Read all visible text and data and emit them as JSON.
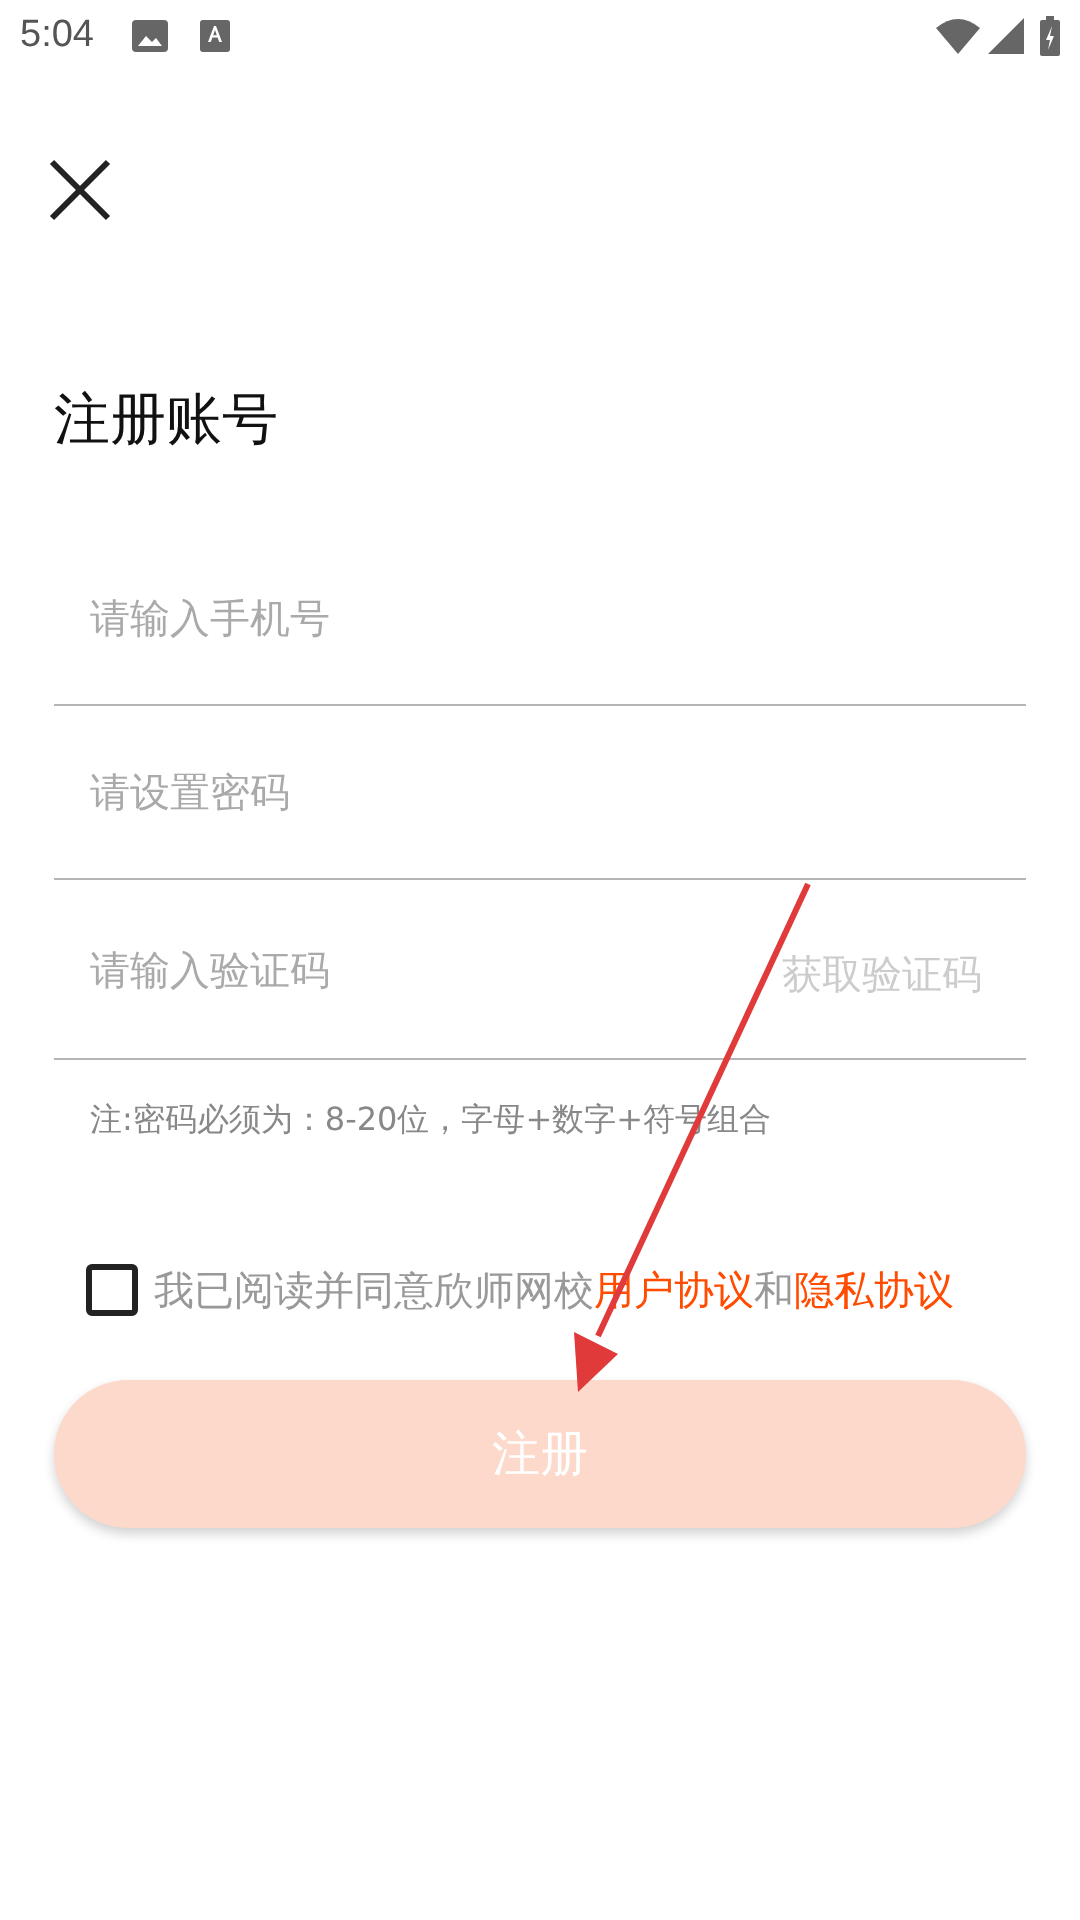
{
  "status_bar": {
    "time": "5:04"
  },
  "title": "注册账号",
  "fields": [
    {
      "placeholder": "请输入手机号"
    },
    {
      "placeholder": "请设置密码"
    },
    {
      "placeholder": "请输入验证码",
      "action": "获取验证码"
    }
  ],
  "hint": "注:密码必须为：8-20位，字母+数字+符号组合",
  "agreement": {
    "checked": false,
    "text": "我已阅读并同意欣师网校",
    "link_1": "用户协议",
    "joiner": "和",
    "link_2": "隐私协议"
  },
  "submit": {
    "label": "注册",
    "disabled": true
  },
  "annotation_arrow": true
}
